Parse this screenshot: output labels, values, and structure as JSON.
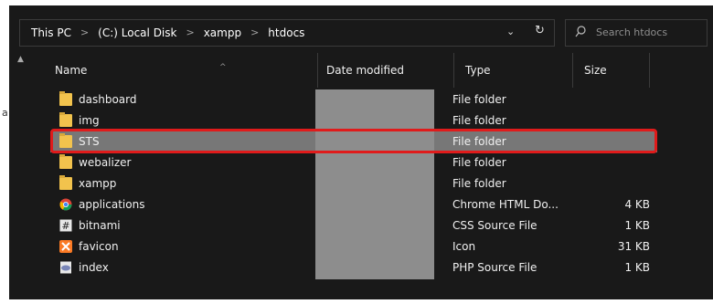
{
  "breadcrumb": [
    {
      "label": "This PC"
    },
    {
      "label": "(C:) Local Disk"
    },
    {
      "label": "xampp"
    },
    {
      "label": "htdocs"
    }
  ],
  "breadcrumb_separator": ">",
  "address_dropdown_glyph": "⌄",
  "refresh_glyph": "↻",
  "search": {
    "placeholder": "Search htdocs"
  },
  "columns": {
    "name": "Name",
    "date_modified": "Date modified",
    "type": "Type",
    "size": "Size"
  },
  "files": [
    {
      "name": "dashboard",
      "type": "File folder",
      "size": "",
      "icon": "folder-icon"
    },
    {
      "name": "img",
      "type": "File folder",
      "size": "",
      "icon": "folder-icon"
    },
    {
      "name": "STS",
      "type": "File folder",
      "size": "",
      "icon": "folder-icon",
      "selected": true
    },
    {
      "name": "webalizer",
      "type": "File folder",
      "size": "",
      "icon": "folder-icon"
    },
    {
      "name": "xampp",
      "type": "File folder",
      "size": "",
      "icon": "folder-icon"
    },
    {
      "name": "applications",
      "type": "Chrome HTML Do...",
      "size": "4 KB",
      "icon": "chrome-icon"
    },
    {
      "name": "bitnami",
      "type": "CSS Source File",
      "size": "1 KB",
      "icon": "css-file-icon"
    },
    {
      "name": "favicon",
      "type": "Icon",
      "size": "31 KB",
      "icon": "xampp-icon"
    },
    {
      "name": "index",
      "type": "PHP Source File",
      "size": "1 KB",
      "icon": "php-file-icon"
    }
  ],
  "colors": {
    "selection": "#777777",
    "highlight": "#e01b1b",
    "background": "#191919"
  }
}
